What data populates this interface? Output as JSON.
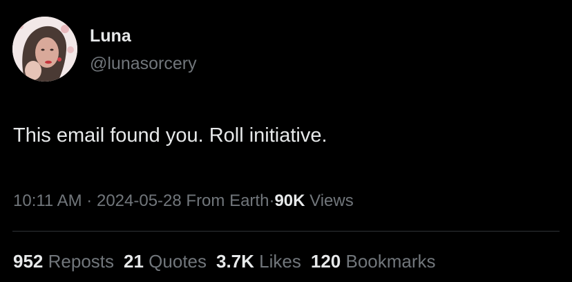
{
  "author": {
    "name": "Luna",
    "handle": "@lunasorcery"
  },
  "tweet": {
    "text": "This email found you. Roll initiative."
  },
  "meta": {
    "time": "10:11 AM",
    "separator": "·",
    "date": "2024-05-28",
    "location": "From Earth",
    "views_count": "90K",
    "views_label": "Views"
  },
  "stats": {
    "reposts_count": "952",
    "reposts_label": "Reposts",
    "quotes_count": "21",
    "quotes_label": "Quotes",
    "likes_count": "3.7K",
    "likes_label": "Likes",
    "bookmarks_count": "120",
    "bookmarks_label": "Bookmarks"
  },
  "colors": {
    "background": "#000000",
    "primary_text": "#e7e9ea",
    "secondary_text": "#71767b",
    "divider": "#2f3336"
  }
}
